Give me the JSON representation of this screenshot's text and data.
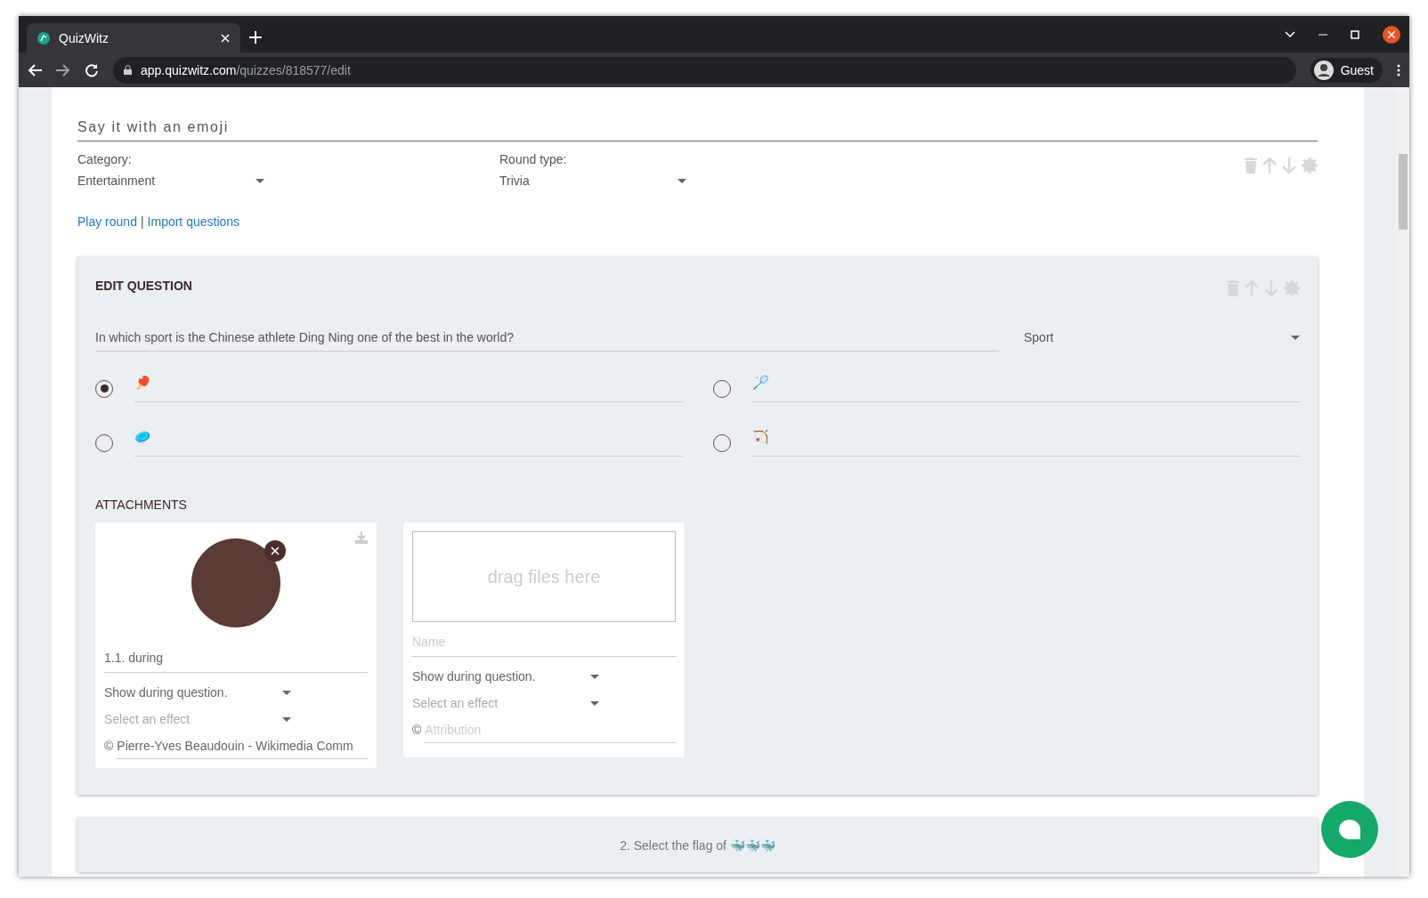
{
  "browser": {
    "tab_title": "QuizWitz",
    "url_domain": "app.quizwitz.com",
    "url_path": "/quizzes/818577/edit",
    "profile": "Guest"
  },
  "round": {
    "title": "Say it with an emoji",
    "category_label": "Category:",
    "category": "Entertainment",
    "round_type_label": "Round type:",
    "round_type": "Trivia",
    "links": [
      "Play round",
      "Import questions"
    ],
    "separator": "|"
  },
  "edit_question": {
    "heading": "EDIT QUESTION",
    "question": "In which sport is the Chinese athlete Ding Ning one of the best in the world?",
    "category": "Sport",
    "answers": [
      {
        "text": "🏓",
        "selected": true
      },
      {
        "text": "🏸",
        "selected": false
      },
      {
        "text": "🥏",
        "selected": false
      },
      {
        "text": "🏹",
        "selected": false
      }
    ],
    "attachments_heading": "ATTACHMENTS",
    "attachments": [
      {
        "kind": "image",
        "name": "1.1. during",
        "show": "Show during question.",
        "effect_placeholder": "Select an effect",
        "copyright": "©",
        "attribution": "Pierre-Yves Beaudouin - Wikimedia Comm"
      },
      {
        "kind": "upload",
        "drop_text": "drag files here",
        "name_placeholder": "Name",
        "show": "Show during question.",
        "effect_placeholder": "Select an effect",
        "copyright": "©",
        "attribution_placeholder": "Attribution"
      }
    ]
  },
  "next_question": {
    "text": "2. Select the flag of 🐳🐳🐳"
  }
}
